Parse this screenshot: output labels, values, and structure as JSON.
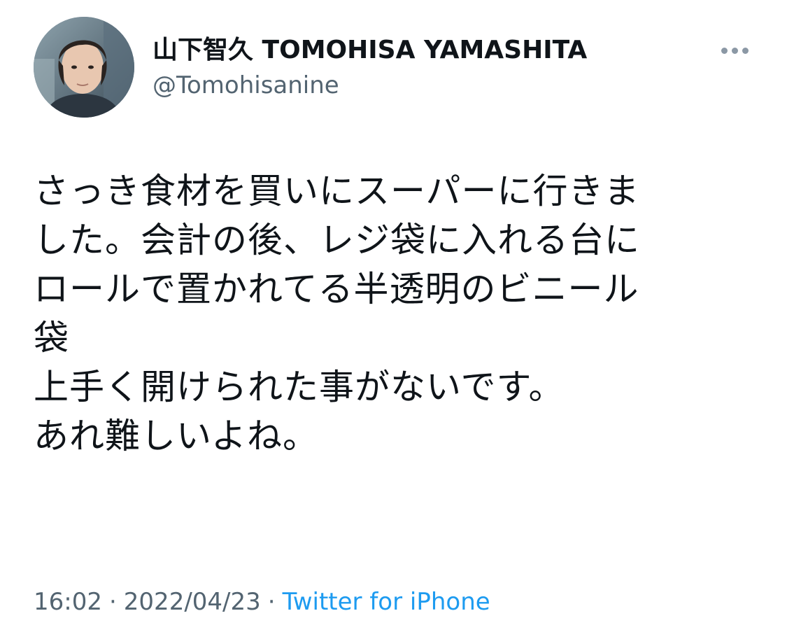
{
  "tweet": {
    "author": {
      "display_name": "山下智久 TOMOHISA YAMASHITA",
      "handle": "@Tomohisanine"
    },
    "more_icon": "more-horizontal-icon",
    "text_lines": [
      "さっき食材を買いにスーパーに行きま",
      "した。会計の後、レジ袋に入れる台に",
      "ロールで置かれてる半透明のビニール",
      "袋",
      "上手く開けられた事がないです。",
      "あれ難しいよね。"
    ],
    "time": "16:02",
    "date": "2022/04/23",
    "separator": "·",
    "source": "Twitter for iPhone"
  },
  "colors": {
    "text_primary": "#0f1419",
    "text_secondary": "#536471",
    "link": "#1d9bf0",
    "background": "#ffffff"
  }
}
